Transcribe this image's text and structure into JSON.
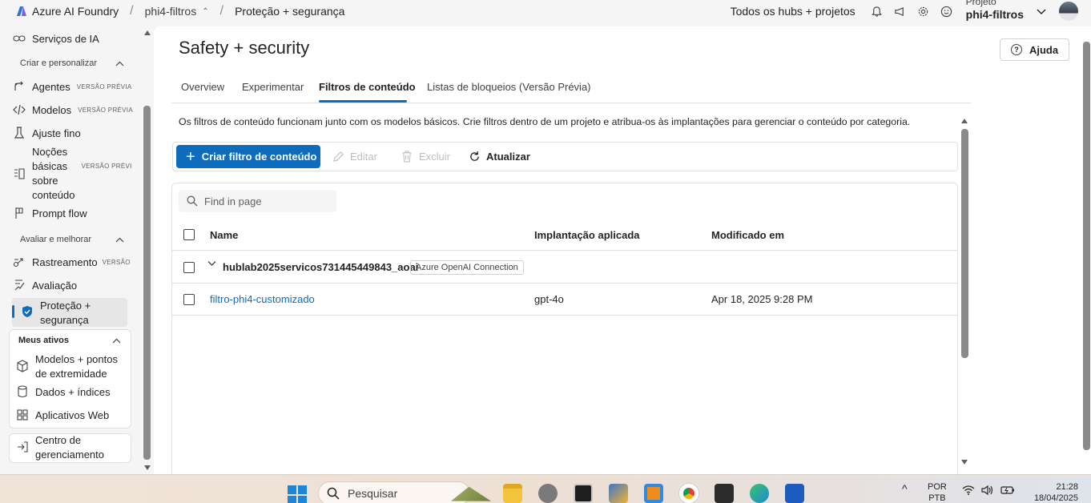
{
  "topbar": {
    "brand": "Azure AI Foundry",
    "crumb_project": "phi4-filtros",
    "crumb_page": "Proteção + segurança",
    "hubs_link": "Todos os hubs + projetos",
    "project_label": "Projeto",
    "project_name": "phi4-filtros"
  },
  "sidebar": {
    "ai_services": "Serviços de IA",
    "section_create": "Criar e personalizar",
    "agents": "Agentes",
    "models": "Modelos",
    "fine_tune": "Ajuste fino",
    "content_basics": "Noções básicas sobre conteúdo",
    "prompt_flow": "Prompt flow",
    "section_eval": "Avaliar e melhorar",
    "tracing": "Rastreamento",
    "tracing_badge": "VERSÃO",
    "evaluation": "Avaliação",
    "safety": "Proteção + segurança",
    "preview_badge": "VERSÃO PRÉVIA",
    "preview_badge_short": "VERSÃO PRÉVI",
    "section_assets": "Meus ativos",
    "models_endpoints": "Modelos + pontos de extremidade",
    "data_indexes": "Dados + índices",
    "web_apps": "Aplicativos Web",
    "management": "Centro de gerenciamento"
  },
  "main": {
    "title": "Safety + security",
    "help": "Ajuda",
    "tabs": [
      {
        "label": "Overview"
      },
      {
        "label": "Experimentar"
      },
      {
        "label": "Filtros de conteúdo"
      },
      {
        "label": "Listas de bloqueios (Versão Prévia)"
      }
    ],
    "description": "Os filtros de conteúdo funcionam junto com os modelos básicos. Crie filtros dentro de um projeto e atribua-os às implantações para gerenciar o conteúdo por categoria.",
    "toolbar": {
      "create": "Criar filtro de conteúdo",
      "edit": "Editar",
      "delete": "Excluir",
      "refresh": "Atualizar"
    },
    "search_placeholder": "Find in page",
    "columns": [
      "Name",
      "Implantação aplicada",
      "Modificado em"
    ],
    "group": {
      "name": "hublab2025servicos731445449843_aoai",
      "badge": "Azure OpenAI Connection"
    },
    "rows": [
      {
        "name": "filtro-phi4-customizado",
        "deployment": "gpt-4o",
        "modified": "Apr 18, 2025 9:28 PM"
      }
    ]
  },
  "taskbar": {
    "search_placeholder": "Pesquisar",
    "lang_top": "POR",
    "lang_bottom": "PTB",
    "time": "21:28",
    "date": "18/04/2025"
  }
}
